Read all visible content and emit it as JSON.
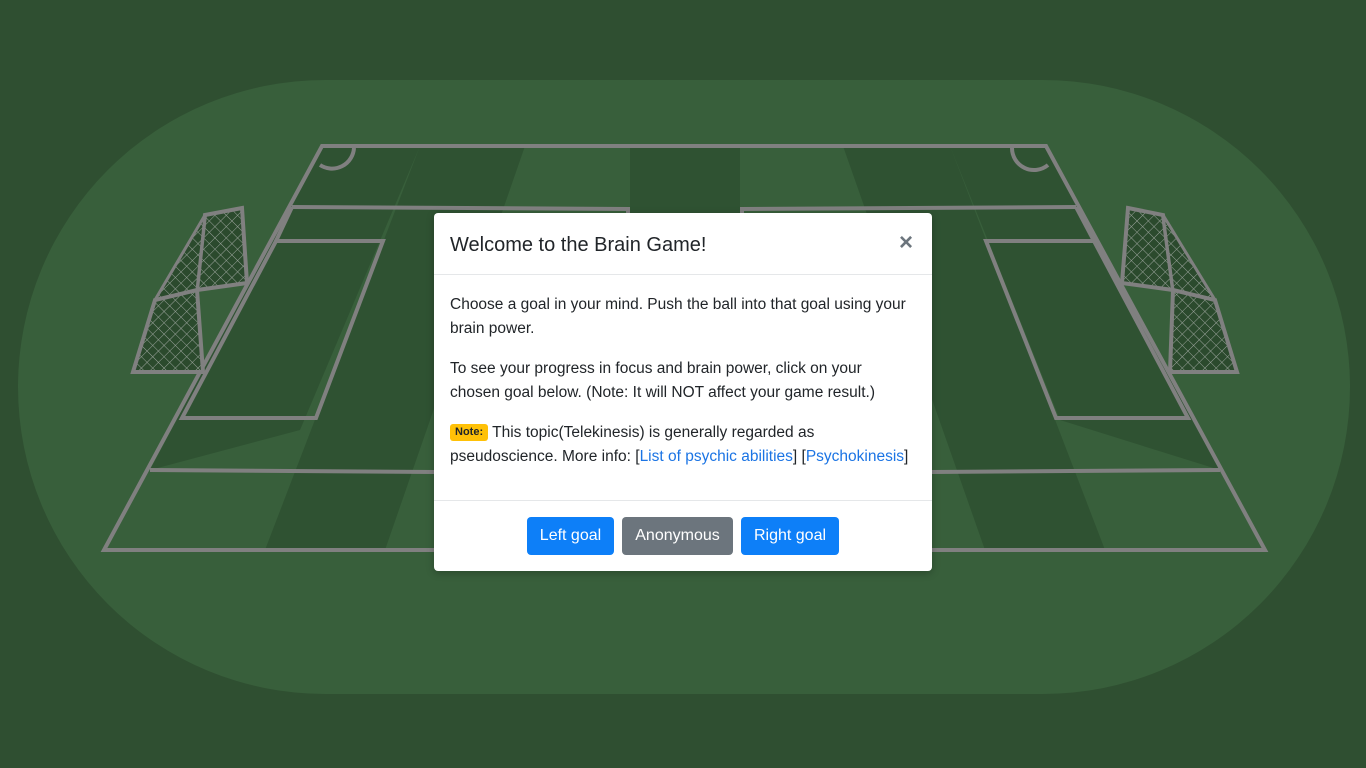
{
  "modal": {
    "title": "Welcome to the Brain Game!",
    "close_label": "×",
    "paragraph1": "Choose a goal in your mind. Push the ball into that goal using your brain power.",
    "paragraph2": "To see your progress in focus and brain power, click on your chosen goal below. (Note: It will NOT affect your game result.)",
    "note_badge": "Note:",
    "note_text_before": " This topic(Telekinesis) is generally regarded as pseudoscience. More info: [",
    "link1": "List of psychic abilities",
    "note_text_between": "] [",
    "link2": "Psychokinesis",
    "note_text_after": "]"
  },
  "buttons": {
    "left_goal": "Left goal",
    "anonymous": "Anonymous",
    "right_goal": "Right goal"
  },
  "colors": {
    "background": "#2f4f31",
    "track": "#385f3b",
    "pitch_stripe_dark": "#2f5232",
    "lines": "#808080",
    "primary": "#0d7ff8",
    "secondary": "#6c757d",
    "badge": "#ffc107"
  }
}
